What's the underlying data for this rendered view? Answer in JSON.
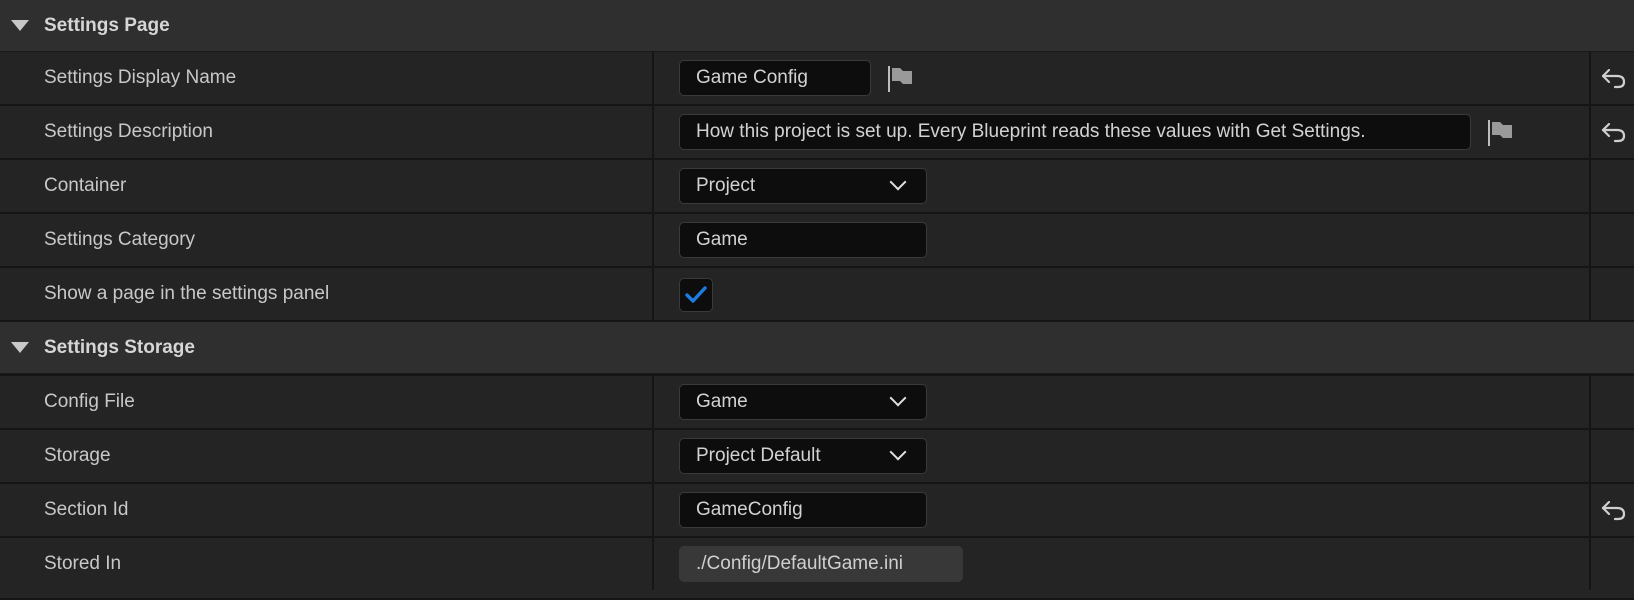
{
  "sections": [
    {
      "title": "Settings Page",
      "rows": [
        {
          "label": "Settings Display Name",
          "value": "Game Config"
        },
        {
          "label": "Settings Description",
          "value": "How this project is set up. Every Blueprint reads these values with Get Settings."
        },
        {
          "label": "Container",
          "value": "Project"
        },
        {
          "label": "Settings Category",
          "value": "Game"
        },
        {
          "label": "Show a page in the settings panel",
          "checked": true
        }
      ]
    },
    {
      "title": "Settings Storage",
      "rows": [
        {
          "label": "Config File",
          "value": "Game"
        },
        {
          "label": "Storage",
          "value": "Project Default"
        },
        {
          "label": "Section Id",
          "value": "GameConfig"
        },
        {
          "label": "Stored In",
          "value": "./Config/DefaultGame.ini"
        }
      ]
    }
  ],
  "icons": {
    "expand": "triangle-down-icon",
    "localize": "flag-icon",
    "reset": "reset-arrow-icon",
    "dropdown": "chevron-down-icon",
    "check": "checkmark-icon"
  },
  "colors": {
    "accent_check": "#1e7be0",
    "panel_bg": "#242424",
    "header_bg": "#2f2f2f",
    "field_bg": "#0d0d0d"
  }
}
